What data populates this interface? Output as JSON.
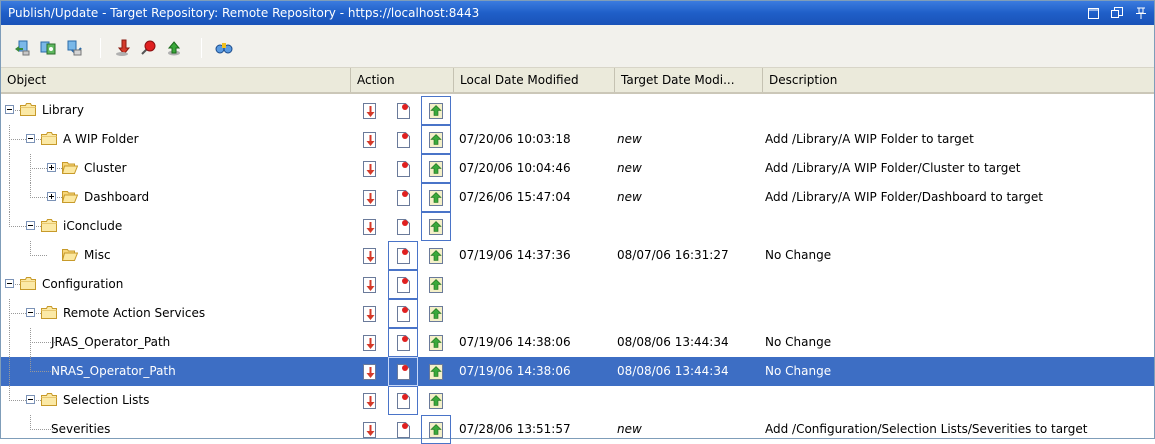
{
  "window": {
    "title": "Publish/Update - Target Repository: Remote Repository - https://localhost:8443",
    "buttons": [
      "maximize-icon",
      "restore-icon",
      "pin-icon"
    ]
  },
  "toolbar": {
    "icons": [
      "sync-icon",
      "sync-all-icon",
      "sync-selected-icon",
      "update-icon",
      "pin-red-icon",
      "publish-icon",
      "compare-icon"
    ]
  },
  "columns": {
    "object": "Object",
    "action": "Action",
    "local_date": "Local Date Modified",
    "target_date": "Target Date Modi...",
    "description": "Description"
  },
  "rows": [
    {
      "label": "Library",
      "level": 0,
      "type": "folder",
      "toggle": "minus",
      "local": "",
      "target": "",
      "description": "",
      "selected_action": "publish"
    },
    {
      "label": "A WIP Folder",
      "level": 1,
      "type": "folder",
      "toggle": "minus",
      "local": "07/20/06 10:03:18",
      "target": "new",
      "description": "Add /Library/A WIP Folder to target",
      "selected_action": "publish"
    },
    {
      "label": "Cluster",
      "level": 2,
      "type": "folder-open",
      "toggle": "plus",
      "local": "07/20/06 10:04:46",
      "target": "new",
      "description": "Add /Library/A WIP Folder/Cluster to target",
      "selected_action": "publish"
    },
    {
      "label": "Dashboard",
      "level": 2,
      "type": "folder-open",
      "toggle": "plus",
      "local": "07/26/06 15:47:04",
      "target": "new",
      "description": "Add /Library/A WIP Folder/Dashboard to target",
      "selected_action": "publish"
    },
    {
      "label": "iConclude",
      "level": 1,
      "type": "folder",
      "toggle": "minus",
      "local": "",
      "target": "",
      "description": "",
      "selected_action": "publish"
    },
    {
      "label": "Misc",
      "level": 2,
      "type": "folder-open",
      "toggle": "none",
      "local": "07/19/06 14:37:36",
      "target": "08/07/06 16:31:27",
      "description": "No Change",
      "selected_action": "none"
    },
    {
      "label": "Configuration",
      "level": 0,
      "type": "folder",
      "toggle": "minus",
      "local": "",
      "target": "",
      "description": "",
      "selected_action": "none"
    },
    {
      "label": "Remote Action Services",
      "level": 1,
      "type": "folder",
      "toggle": "minus",
      "local": "",
      "target": "",
      "description": "",
      "selected_action": "none"
    },
    {
      "label": "JRAS_Operator_Path",
      "level": 2,
      "type": "item",
      "toggle": "none",
      "local": "07/19/06 14:38:06",
      "target": "08/08/06 13:44:34",
      "description": "No Change",
      "selected_action": "none"
    },
    {
      "label": "NRAS_Operator_Path",
      "level": 2,
      "type": "item",
      "toggle": "none",
      "local": "07/19/06 14:38:06",
      "target": "08/08/06 13:44:34",
      "description": "No Change",
      "selected_action": "none",
      "selected": true
    },
    {
      "label": "Selection Lists",
      "level": 1,
      "type": "folder",
      "toggle": "minus",
      "local": "",
      "target": "",
      "description": "",
      "selected_action": "none"
    },
    {
      "label": "Severities",
      "level": 2,
      "type": "item",
      "toggle": "none",
      "local": "07/28/06 13:51:57",
      "target": "new",
      "description": "Add /Configuration/Selection Lists/Severities to target",
      "selected_action": "publish"
    }
  ],
  "colors": {
    "title_bar": "#1f5fc8",
    "selection": "#3d6ec4",
    "header_bg": "#ebeadb",
    "toolbar_bg": "#f2f1ec"
  }
}
